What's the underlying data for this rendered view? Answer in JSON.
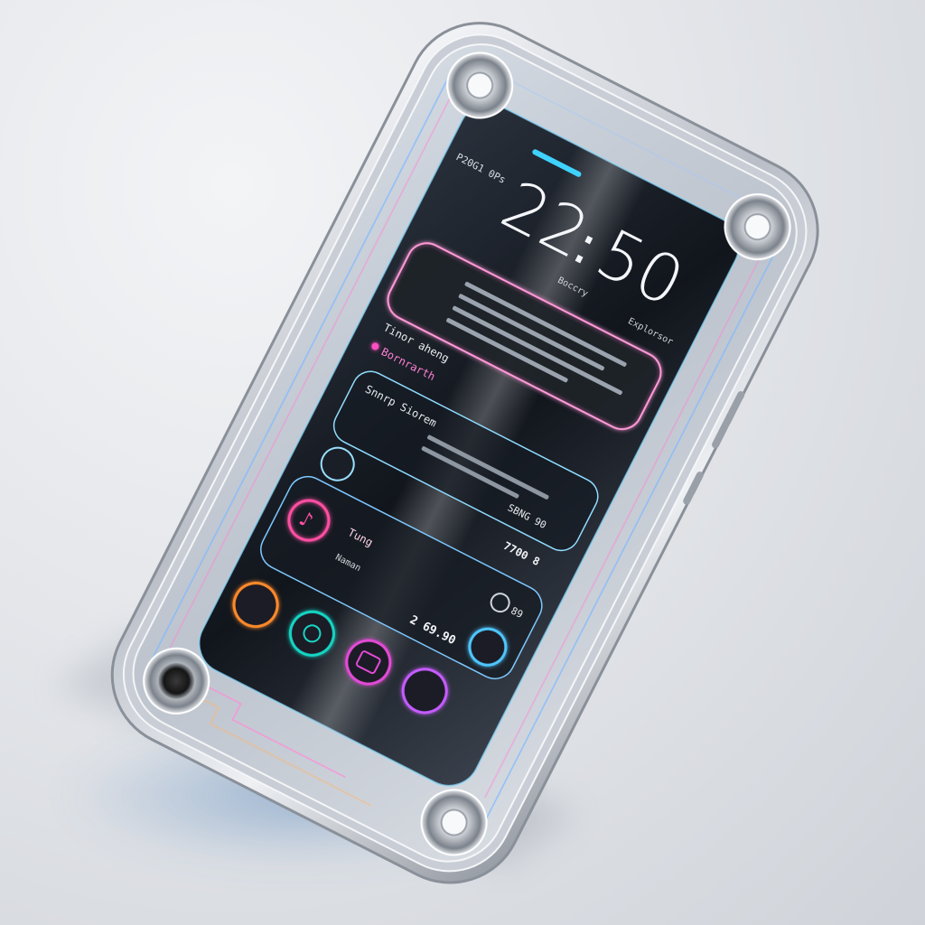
{
  "clock": {
    "hours": "22",
    "separator": ":",
    "minutes": "50"
  },
  "lockscreen": {
    "left_caption": "P20G1 0Ps",
    "caption_under_clock": "Boccry",
    "caption_right": "Explorsor"
  },
  "cards": {
    "row1_title": "Tinor aheng",
    "row2_title": "Bornrarth",
    "row3_title": "Snnrp Siorem",
    "side_value_1": "SBNG 90",
    "side_value_2": "7700 8",
    "music_label": "Tung",
    "music_sub": "Naman",
    "price": "2 69.90",
    "small_value": "89"
  },
  "apps": [
    {
      "name": "music-app",
      "color": "#ff4fa3"
    },
    {
      "name": "reader-app",
      "color": "#ff8a2a"
    },
    {
      "name": "target-app",
      "color": "#19d4c4"
    },
    {
      "name": "media-app",
      "color": "#e24bd6"
    },
    {
      "name": "photos-app",
      "color": "#c65cff"
    },
    {
      "name": "navigate-app",
      "color": "#4fc6ff"
    },
    {
      "name": "shortcut-app",
      "color": "#4fa8ff"
    }
  ],
  "colors": {
    "neon_pink": "#ff4fc3",
    "neon_cyan": "#3fd2ff",
    "neon_orange": "#ff9a3c",
    "screen_dark": "#151a22",
    "frame_silver": "#c9ced6"
  }
}
